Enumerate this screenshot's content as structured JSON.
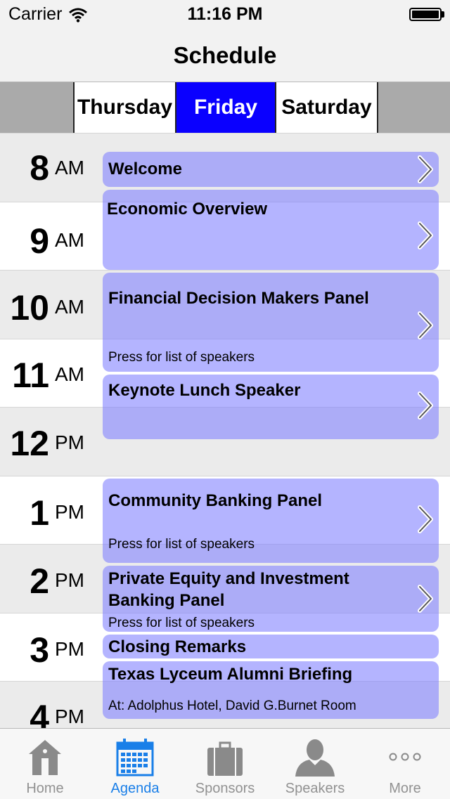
{
  "status_bar": {
    "carrier": "Carrier",
    "time": "11:16 PM"
  },
  "nav": {
    "title": "Schedule"
  },
  "days": [
    {
      "label": "Thursday",
      "active": false
    },
    {
      "label": "Friday",
      "active": true
    },
    {
      "label": "Saturday",
      "active": false
    }
  ],
  "hours": [
    {
      "num": "8",
      "ampm": "AM"
    },
    {
      "num": "9",
      "ampm": "AM"
    },
    {
      "num": "10",
      "ampm": "AM"
    },
    {
      "num": "11",
      "ampm": "AM"
    },
    {
      "num": "12",
      "ampm": "PM"
    },
    {
      "num": "1",
      "ampm": "PM"
    },
    {
      "num": "2",
      "ampm": "PM"
    },
    {
      "num": "3",
      "ampm": "PM"
    },
    {
      "num": "4",
      "ampm": "PM"
    }
  ],
  "events": [
    {
      "title": "Welcome",
      "subtitle": ""
    },
    {
      "title": "Economic Overview",
      "subtitle": ""
    },
    {
      "title": "Financial Decision Makers Panel",
      "subtitle": "Press for list of speakers"
    },
    {
      "title": "Keynote Lunch Speaker",
      "subtitle": ""
    },
    {
      "title": "Community Banking Panel",
      "subtitle": "Press for list of speakers"
    },
    {
      "title": "Private Equity and Investment Banking Panel",
      "subtitle": "Press for list of speakers"
    },
    {
      "title": "Closing Remarks",
      "subtitle": ""
    },
    {
      "title": "Texas Lyceum Alumni Briefing",
      "subtitle": "At: Adolphus Hotel, David G.Burnet Room"
    }
  ],
  "tabs": [
    {
      "label": "Home",
      "icon": "home-icon",
      "active": false
    },
    {
      "label": "Agenda",
      "icon": "calendar-icon",
      "active": true
    },
    {
      "label": "Sponsors",
      "icon": "briefcase-icon",
      "active": false
    },
    {
      "label": "Speakers",
      "icon": "person-icon",
      "active": false
    },
    {
      "label": "More",
      "icon": "more-icon",
      "active": false
    }
  ],
  "colors": {
    "active_day": "#0a00ff",
    "event_fill": "#7d7dff",
    "tab_active": "#1a7fe8",
    "tab_inactive": "#929292"
  }
}
